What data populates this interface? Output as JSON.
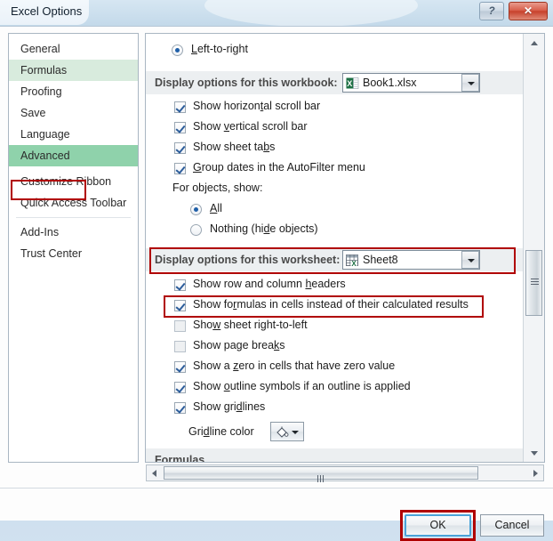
{
  "window": {
    "title": "Excel Options",
    "help_button": "?",
    "close_button": "✕"
  },
  "sidebar": {
    "items": [
      {
        "label": "General",
        "state": "normal"
      },
      {
        "label": "Formulas",
        "state": "hover"
      },
      {
        "label": "Proofing",
        "state": "normal"
      },
      {
        "label": "Save",
        "state": "normal"
      },
      {
        "label": "Language",
        "state": "normal"
      },
      {
        "label": "Advanced",
        "state": "selected"
      },
      {
        "label": "Customize Ribbon",
        "state": "normal"
      },
      {
        "label": "Quick Access Toolbar",
        "state": "normal"
      },
      {
        "label": "Add-Ins",
        "state": "normal"
      },
      {
        "label": "Trust Center",
        "state": "normal"
      }
    ]
  },
  "content": {
    "direction_radio": {
      "label": "Left-to-right",
      "checked": true
    },
    "workbook_section": {
      "heading": "Display options for this workbook:",
      "dropdown_value": "Book1.xlsx",
      "dropdown_icon": "excel-workbook-icon",
      "options": [
        {
          "label": "Show horizontal scroll bar",
          "checked": true,
          "enabled": true
        },
        {
          "label": "Show vertical scroll bar",
          "checked": true,
          "enabled": true
        },
        {
          "label": "Show sheet tabs",
          "checked": true,
          "enabled": true
        },
        {
          "label": "Group dates in the AutoFilter menu",
          "checked": true,
          "enabled": true
        }
      ],
      "objects_label": "For objects, show:",
      "objects_radios": [
        {
          "label": "All",
          "checked": true
        },
        {
          "label": "Nothing (hide objects)",
          "checked": false
        }
      ]
    },
    "worksheet_section": {
      "heading": "Display options for this worksheet:",
      "dropdown_value": "Sheet8",
      "dropdown_icon": "excel-worksheet-icon",
      "options": [
        {
          "label": "Show row and column headers",
          "checked": true,
          "enabled": true
        },
        {
          "label": "Show formulas in cells instead of their calculated results",
          "checked": true,
          "enabled": true
        },
        {
          "label": "Show sheet right-to-left",
          "checked": false,
          "enabled": false
        },
        {
          "label": "Show page breaks",
          "checked": false,
          "enabled": false
        },
        {
          "label": "Show a zero in cells that have zero value",
          "checked": true,
          "enabled": true
        },
        {
          "label": "Show outline symbols if an outline is applied",
          "checked": true,
          "enabled": true
        },
        {
          "label": "Show gridlines",
          "checked": true,
          "enabled": true
        }
      ],
      "gridline_color_label": "Gridline color",
      "gridline_color_icon": "paint-bucket-icon"
    },
    "formulas_section": {
      "heading": "Formulas"
    }
  },
  "footer": {
    "ok_label": "OK",
    "cancel_label": "Cancel"
  },
  "annotations": {
    "color": "#b00000",
    "targets": [
      "sidebar-item-advanced",
      "worksheet-dropdown-row",
      "show-formulas-checkbox-row",
      "ok-button"
    ]
  }
}
